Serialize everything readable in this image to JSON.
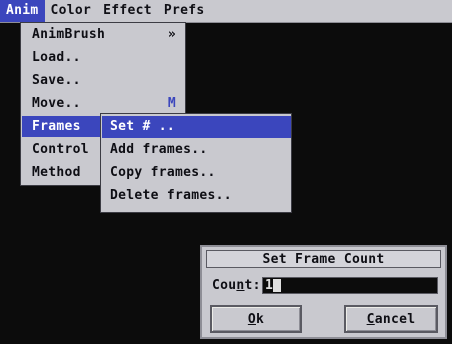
{
  "menubar": {
    "items": [
      {
        "label": "Anim",
        "active": true
      },
      {
        "label": "Color",
        "active": false
      },
      {
        "label": "Effect",
        "active": false
      },
      {
        "label": "Prefs",
        "active": false
      }
    ]
  },
  "anim_menu": {
    "items": [
      {
        "label": "AnimBrush",
        "submenu_marker": "»"
      },
      {
        "label": "Load.."
      },
      {
        "label": "Save.."
      },
      {
        "label": "Move..",
        "shortcut": "M"
      },
      {
        "label": "Frames",
        "selected": true
      },
      {
        "label": "Control"
      },
      {
        "label": "Method"
      }
    ]
  },
  "frames_submenu": {
    "items": [
      {
        "label": "Set # ..",
        "selected": true
      },
      {
        "label": "Add frames.."
      },
      {
        "label": "Copy frames.."
      },
      {
        "label": "Delete frames.."
      }
    ]
  },
  "dialog": {
    "title": "Set Frame Count",
    "count_label_prefix": "Cou",
    "count_label_underlined": "n",
    "count_label_suffix": "t:",
    "count_value": "1",
    "ok_underlined": "O",
    "ok_rest": "k",
    "cancel_underlined": "C",
    "cancel_rest": "ancel"
  },
  "colors": {
    "menu_bg": "#c9c9cf",
    "highlight": "#3b46bd",
    "screen_bg": "#0c0c0c"
  }
}
